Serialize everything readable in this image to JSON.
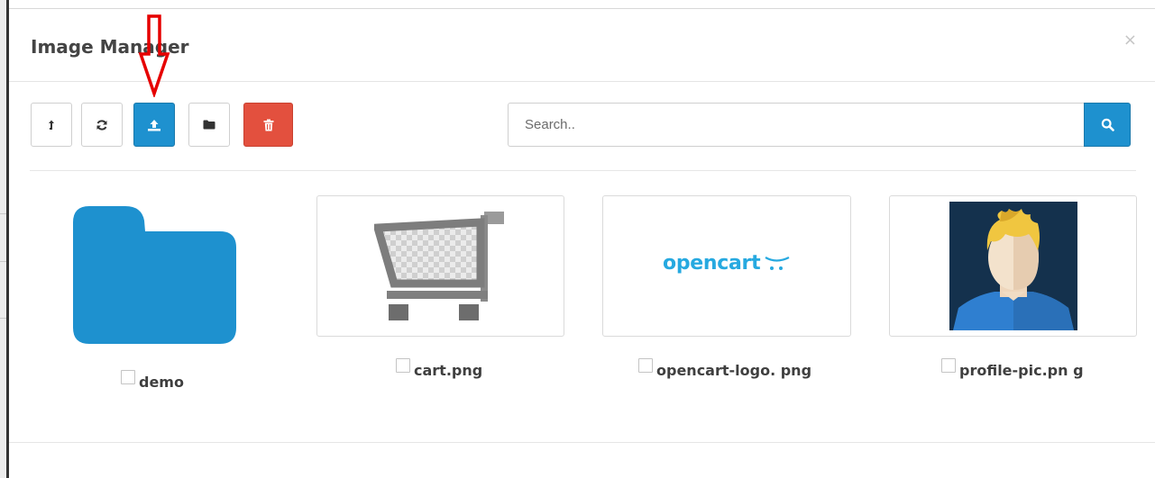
{
  "modal": {
    "title": "Image Manager",
    "close": "×"
  },
  "toolbar": {
    "buttons": [
      {
        "name": "parent-folder",
        "icon": "level-up-icon",
        "style": "default"
      },
      {
        "name": "refresh",
        "icon": "refresh-icon",
        "style": "default"
      },
      {
        "name": "upload",
        "icon": "upload-icon",
        "style": "primary"
      },
      {
        "name": "new-folder",
        "icon": "folder-icon",
        "style": "default"
      },
      {
        "name": "delete",
        "icon": "trash-icon",
        "style": "danger"
      }
    ]
  },
  "search": {
    "placeholder": "Search..",
    "value": "",
    "button_icon": "search-icon"
  },
  "items": [
    {
      "type": "folder",
      "name": "demo"
    },
    {
      "type": "image",
      "name": "cart.png",
      "thumb": "cart-thumbnail"
    },
    {
      "type": "image",
      "name": "opencart-logo. png",
      "thumb": "opencart-logo-thumbnail",
      "logo_text": "opencart"
    },
    {
      "type": "image",
      "name": "profile-pic.pn g",
      "thumb": "profile-pic-thumbnail"
    }
  ],
  "colors": {
    "primary": "#1e91cf",
    "danger": "#e3503e",
    "folder": "#1e91cf",
    "logo_text": "#26a9e0",
    "annotation_arrow": "#e60000"
  }
}
